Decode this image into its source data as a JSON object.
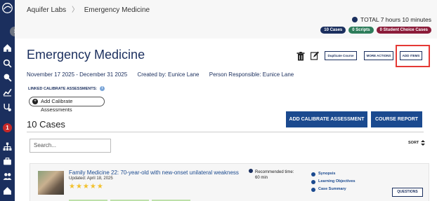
{
  "breadcrumb": {
    "root": "Aquifer Labs",
    "current": "Emergency Medicine"
  },
  "summary": {
    "total": "TOTAL 7 hours 10 minutes",
    "badges": {
      "cases": "10 Cases",
      "scripts": "0 Scripts",
      "student_choice": "0 Student Choice Cases"
    }
  },
  "course": {
    "title": "Emergency Medicine",
    "dates": "November 17 2025 - December 31 2025",
    "created_by": "Created by: Eunice Lane",
    "responsible": "Person Responsible: Eunice Lane"
  },
  "toolbar": {
    "duplicate": "Duplicate Course",
    "more": "MORE ACTIONS",
    "add_items": "ADD ITEMS"
  },
  "calibrate": {
    "linked_label": "LINKED CALIBRATE ASSESSMENTS:",
    "info_icon": "i",
    "add_pill": "Add Calibrate Assessments",
    "add_button": "ADD CALIBRATE ASSESSMENT",
    "report_button": "COURSE REPORT"
  },
  "cases": {
    "heading": "10 Cases",
    "search_placeholder": "Search...",
    "sort_label": "SORT",
    "items": [
      {
        "title": "Family Medicine 22: 70-year-old with new-onset unilateral weakness",
        "updated": "Updated: April 18, 2025",
        "rating": 4.5,
        "stars": "★★★★★",
        "recommended_label": "Recommended time:",
        "recommended_value": "60 min",
        "links": {
          "synopsis": "Synopsis",
          "objectives": "Learning Objectives",
          "summary": "Case Summary"
        },
        "questions": "QUESTIONS"
      }
    ]
  },
  "sidebar": {
    "notification_count": "1",
    "expand": "›"
  },
  "colors": {
    "navy": "#1b2f5e",
    "primary": "#1b4a8f",
    "highlight": "#e53935",
    "star": "#f2c12e"
  }
}
